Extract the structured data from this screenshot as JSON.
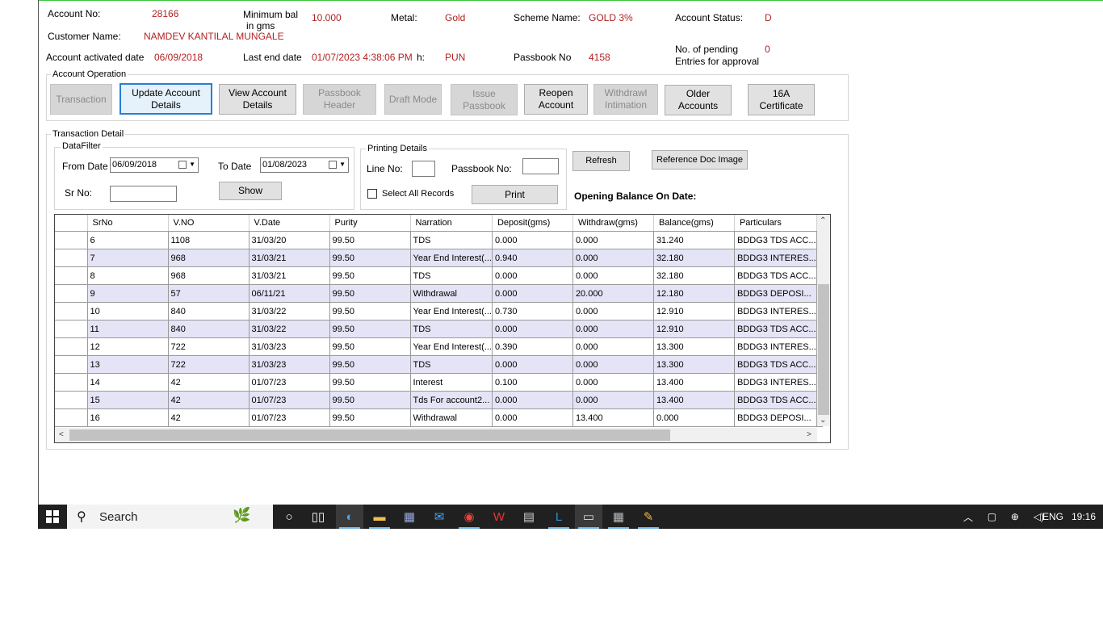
{
  "account": {
    "account_no_label": "Account No:",
    "account_no": "28166",
    "min_bal_label_1": "Minimum bal",
    "min_bal_label_2": "in gms",
    "min_bal": "10.000",
    "metal_label": "Metal:",
    "metal": "Gold",
    "scheme_label": "Scheme Name:",
    "scheme": "GOLD 3%",
    "status_label": "Account Status:",
    "status": "D",
    "customer_label": "Customer Name:",
    "customer": "NAMDEV  KANTILAL MUNGALE",
    "activated_label": "Account activated date",
    "activated": "06/09/2018",
    "last_end_label": "Last end date",
    "last_end": "01/07/2023 4:38:06 PM",
    "branch_label": "h:",
    "branch": "PUN",
    "passbook_label": "Passbook No",
    "passbook": "4158",
    "pending_label_1": "No. of pending",
    "pending_label_2": "Entries for approval",
    "pending": "0"
  },
  "operation": {
    "title": "Account Operation",
    "buttons": {
      "transaction": "Transaction",
      "update_1": "Update Account",
      "update_2": "Details",
      "view_1": "View Account",
      "view_2": "Details",
      "ph_1": "Passbook",
      "ph_2": "Header",
      "draft": "Draft Mode",
      "issue_1": "Issue",
      "issue_2": "Passbook",
      "reopen_1": "Reopen",
      "reopen_2": "Account",
      "withdraw_1": "Withdrawl",
      "withdraw_2": "Intimation",
      "older_1": "Older",
      "older_2": "Accounts",
      "cert_1": "16A",
      "cert_2": "Certificate"
    }
  },
  "transaction_detail": {
    "title": "Transaction Detail",
    "filter_title": "DataFilter",
    "from_label": "From Date",
    "from_value": "06/09/2018",
    "to_label": "To Date",
    "to_value": "01/08/2023",
    "srno_label": "Sr No:",
    "srno_value": "",
    "show": "Show",
    "printing_title": "Printing Details",
    "line_label": "Line No:",
    "line_value": "",
    "pbno_label": "Passbook No:",
    "pbno_value": "",
    "select_all": "Select All Records",
    "print": "Print",
    "refresh": "Refresh",
    "ref_doc": "Reference Doc Image",
    "opening_balance": "Opening Balance On Date:"
  },
  "grid": {
    "columns": [
      "SrNo",
      "V.NO",
      "V.Date",
      "Purity",
      "Narration",
      "Deposit(gms)",
      "Withdraw(gms)",
      "Balance(gms)",
      "Particulars"
    ],
    "rows": [
      [
        "6",
        "1108",
        "31/03/20",
        "99.50",
        "TDS",
        "0.000",
        "0.000",
        "31.240",
        "BDDG3 TDS ACC..."
      ],
      [
        "7",
        "968",
        "31/03/21",
        "99.50",
        "Year End Interest(...",
        "0.940",
        "0.000",
        "32.180",
        "BDDG3 INTERES..."
      ],
      [
        "8",
        "968",
        "31/03/21",
        "99.50",
        "TDS",
        "0.000",
        "0.000",
        "32.180",
        "BDDG3 TDS ACC..."
      ],
      [
        "9",
        "57",
        "06/11/21",
        "99.50",
        "Withdrawal",
        "0.000",
        "20.000",
        "12.180",
        "BDDG3 DEPOSI..."
      ],
      [
        "10",
        "840",
        "31/03/22",
        "99.50",
        "Year End Interest(...",
        "0.730",
        "0.000",
        "12.910",
        "BDDG3 INTERES..."
      ],
      [
        "11",
        "840",
        "31/03/22",
        "99.50",
        "TDS",
        "0.000",
        "0.000",
        "12.910",
        "BDDG3 TDS ACC..."
      ],
      [
        "12",
        "722",
        "31/03/23",
        "99.50",
        "Year End Interest(...",
        "0.390",
        "0.000",
        "13.300",
        "BDDG3 INTERES..."
      ],
      [
        "13",
        "722",
        "31/03/23",
        "99.50",
        "TDS",
        "0.000",
        "0.000",
        "13.300",
        "BDDG3 TDS ACC..."
      ],
      [
        "14",
        "42",
        "01/07/23",
        "99.50",
        "Interest",
        "0.100",
        "0.000",
        "13.400",
        "BDDG3 INTERES..."
      ],
      [
        "15",
        "42",
        "01/07/23",
        "99.50",
        "Tds For account2...",
        "0.000",
        "0.000",
        "13.400",
        "BDDG3 TDS ACC..."
      ],
      [
        "16",
        "42",
        "01/07/23",
        "99.50",
        "Withdrawal",
        "0.000",
        "13.400",
        "0.000",
        "BDDG3 DEPOSI..."
      ]
    ]
  },
  "taskbar": {
    "search_placeholder": "Search",
    "language": "ENG",
    "time": "19:16"
  }
}
